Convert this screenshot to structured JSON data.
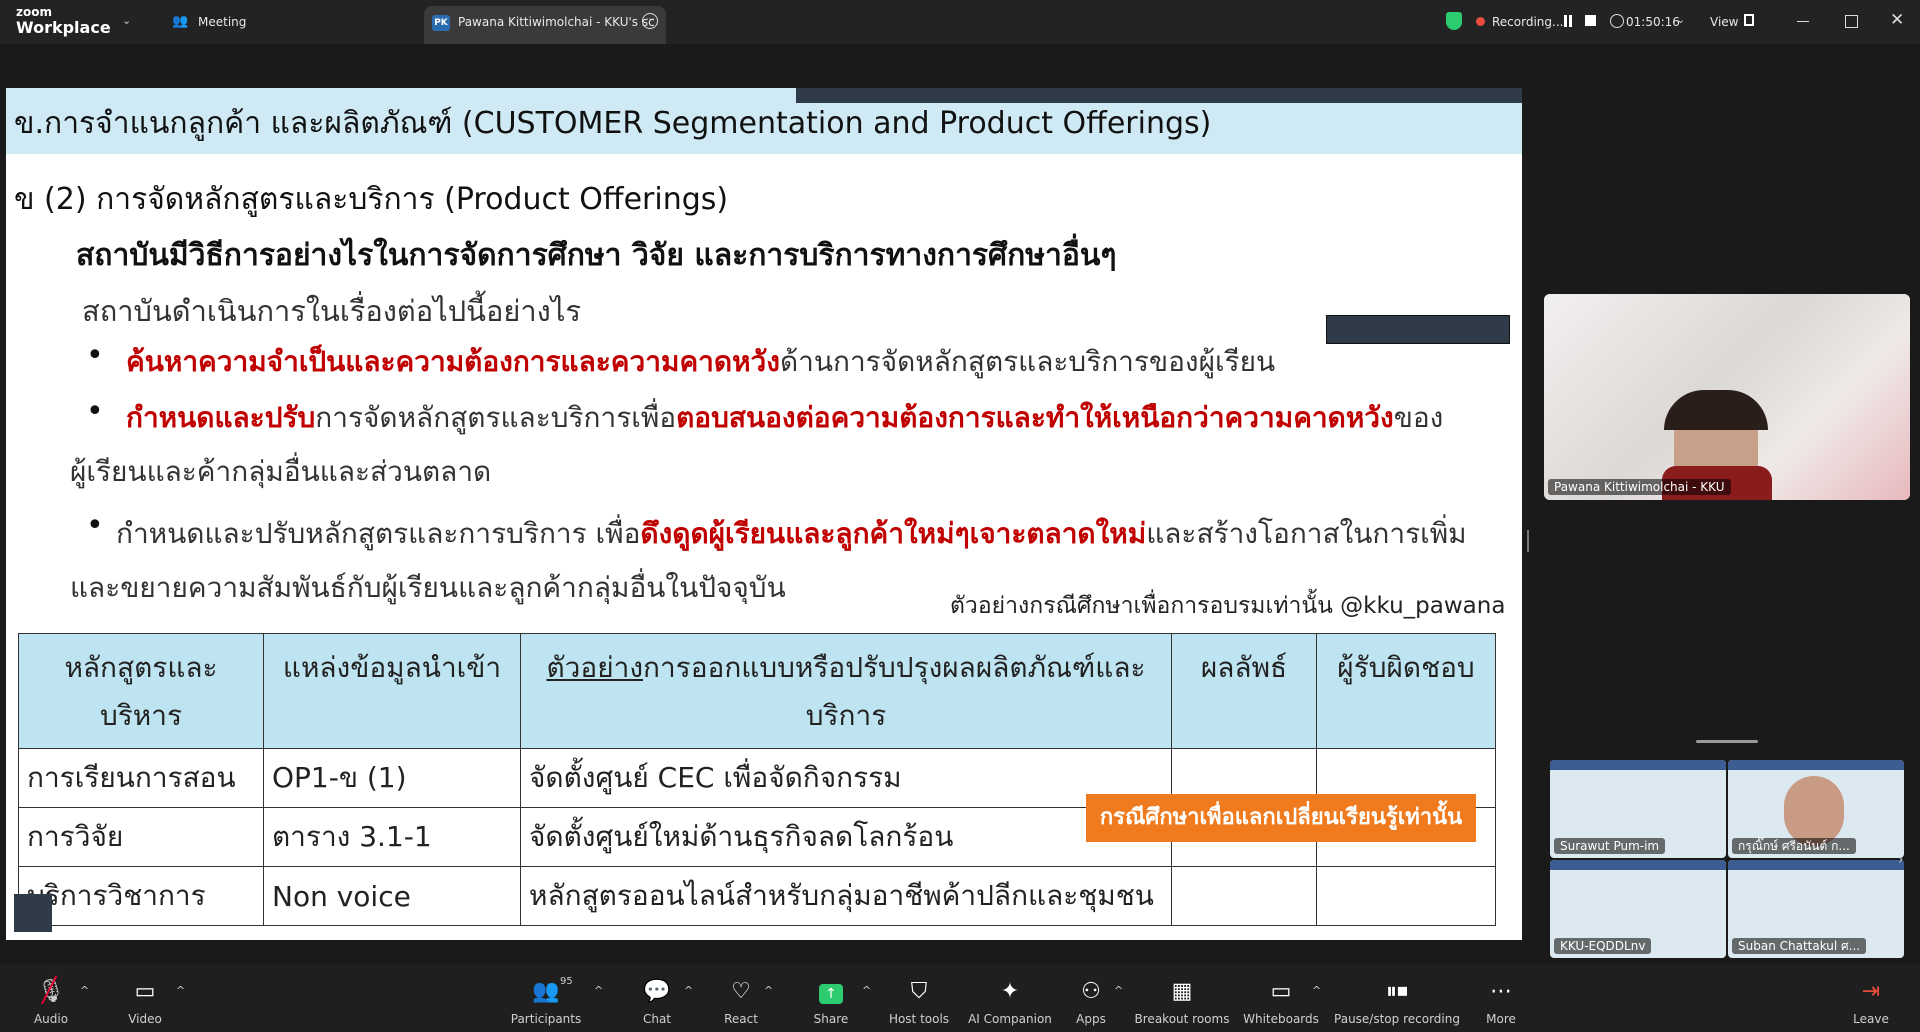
{
  "topbar": {
    "brand_top": "zoom",
    "brand_bottom": "Workplace",
    "meeting_label": "Meeting",
    "tab_initials": "PK",
    "tab_title": "Pawana Kittiwimolchai - KKU's sc",
    "recording_label": "Recording...",
    "timer": "01:50:16",
    "view_label": "View"
  },
  "slide": {
    "header": "ข.การจำแนกลูกค้า และผลิตภัณฑ์ (CUSTOMER Segmentation and Product Offerings)",
    "section_title": "ข (2)  การจัดหลักสูตรและบริการ (Product Offerings)",
    "question": "สถาบันมีวิธีการอย่างไรในการจัดการศึกษา วิจัย และการบริการทางการศึกษาอื่นๆ",
    "subline": "สถาบันดำเนินการในเรื่องต่อไปนี้อย่างไร",
    "b1_red": "ค้นหาความจำเป็นและความต้องการและความคาดหวัง",
    "b1_rest": "ด้านการจัดหลักสูตรและบริการของผู้เรียน",
    "b2_red1": "กำหนดและปรับ",
    "b2_mid": "การจัดหลักสูตรและบริการเพื่อ",
    "b2_red2": "ตอบสนองต่อความต้องการและทำให้เหนือกว่าความคาดหวัง",
    "b2_end": "ของ",
    "b2_line2": "ผู้เรียนและค้ากลุ่มอื่นและส่วนตลาด",
    "b3_start": "กำหนดและปรับหลักสูตรและการบริการ เพื่อ",
    "b3_red": "ดึงดูดผู้เรียนและลูกค้าใหม่ๆเจาะตลาดใหม่",
    "b3_end": "และสร้างโอกาสในการเพิ่ม",
    "b3_line2": "และขยายความสัมพันธ์กับผู้เรียนและลูกค้ากลุ่มอื่นในปัจจุบัน",
    "note": "ตัวอย่างกรณีศึกษาเพื่อการอบรมเท่านั้น @kku_pawana",
    "table": {
      "h1": "หลักสูตรและบริหาร",
      "h2": "แหล่งข้อมูลนำเข้า",
      "h3_underlined": "ตัวอย่าง",
      "h3_rest": "การออกแบบหรือปรับปรุงผลผลิตภัณฑ์และบริการ",
      "h4": "ผลลัพธ์",
      "h5": "ผู้รับผิดชอบ",
      "rows": [
        {
          "c1": "การเรียนการสอน",
          "c2": "OP1-ข (1)",
          "c3": "จัดตั้งศูนย์ CEC เพื่อจัดกิจกรรม"
        },
        {
          "c1": "การวิจัย",
          "c2": "ตาราง 3.1-1",
          "c3": "จัดตั้งศูนย์ใหม่ด้านธุรกิจลดโลกร้อน"
        },
        {
          "c1": "บริการวิชาการ",
          "c2": "Non voice",
          "c3": "หลักสูตรออนไลน์สำหรับกลุ่มอาชีพค้าปลีกและชุมชน"
        }
      ]
    },
    "orange_banner": "กรณีศึกษาเพื่อแลกเปลี่ยนเรียนรู้เท่านั้น"
  },
  "participants": {
    "main_name": "Pawana Kittiwimolchai - KKU",
    "thumbs": [
      "Surawut Pum-im",
      "กรุณิ๊กษ์ ศรีอนันต์ ก...",
      "KKU-EQDDLnv",
      "Suban Chattakul ศ..."
    ]
  },
  "toolbar": {
    "audio": "Audio",
    "video": "Video",
    "participants": "Participants",
    "participants_count": "95",
    "chat": "Chat",
    "react": "React",
    "share": "Share",
    "host_tools": "Host tools",
    "ai_companion": "AI Companion",
    "apps": "Apps",
    "breakout": "Breakout rooms",
    "whiteboards": "Whiteboards",
    "pause_recording": "Pause/stop recording",
    "more": "More",
    "leave": "Leave"
  },
  "colors": {
    "accent_green": "#2ecc71",
    "red_text": "#c00000",
    "orange": "#f07b1f",
    "table_header": "#bfe4f1"
  }
}
